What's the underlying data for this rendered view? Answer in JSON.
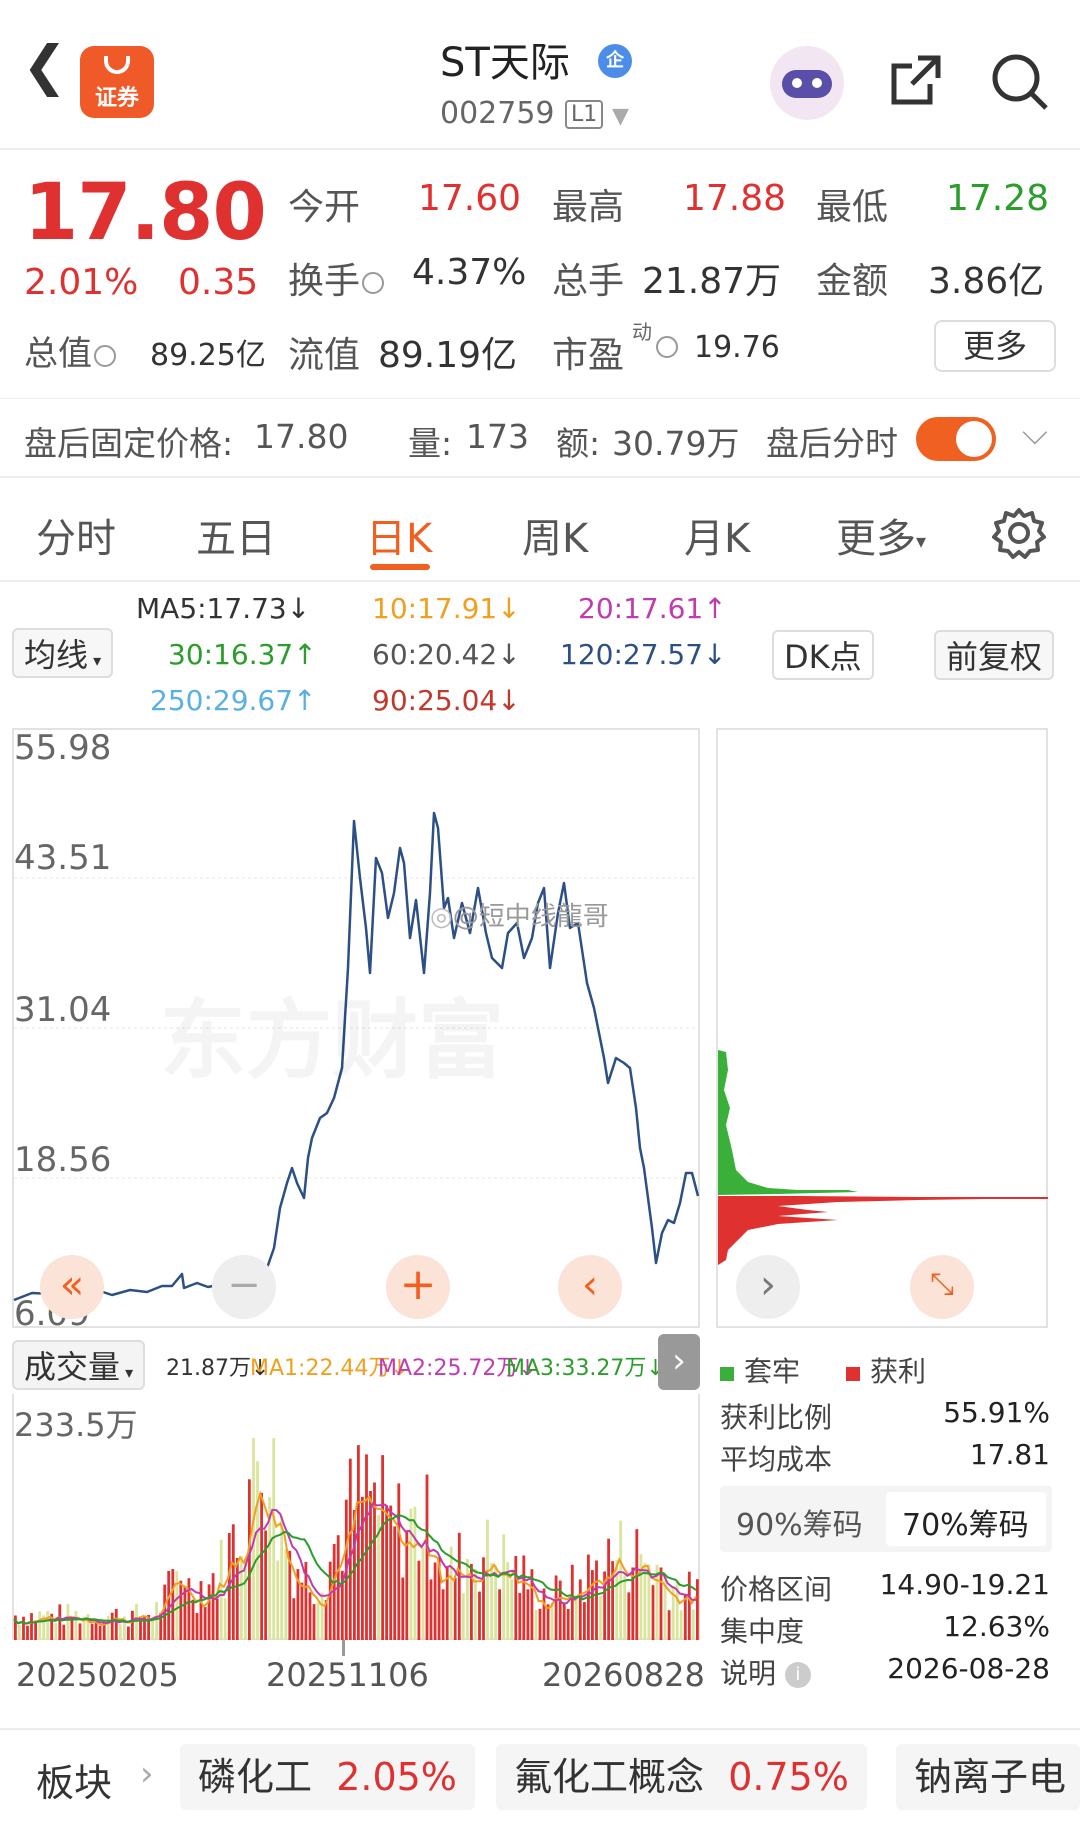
{
  "header": {
    "app_logo_text": "证券",
    "title": "ST天际",
    "title_badge": "企",
    "stock_code": "002759",
    "level_badge": "L1"
  },
  "quote": {
    "price": "17.80",
    "change_pct": "2.01%",
    "change_amt": "0.35",
    "labels": {
      "open": "今开",
      "high": "最高",
      "low": "最低",
      "turnover": "换手",
      "volume": "总手",
      "amount": "金额",
      "total_cap": "总值",
      "float_cap": "流值",
      "pe": "市盈"
    },
    "open": "17.60",
    "high": "17.88",
    "low": "17.28",
    "turnover": "4.37%",
    "volume": "21.87万",
    "amount": "3.86亿",
    "total_cap": "89.25亿",
    "float_cap": "89.19亿",
    "pe_sup": "动",
    "pe": "19.76",
    "more": "更多"
  },
  "after_hours": {
    "label": "盘后固定价格:",
    "price": "17.80",
    "vol_label": "量:",
    "vol": "173",
    "amt_label": "额:",
    "amt": "30.79万",
    "timeshare_label": "盘后分时"
  },
  "tabs": [
    "分时",
    "五日",
    "日K",
    "周K",
    "月K",
    "更多"
  ],
  "active_tab": "日K",
  "ma_legend": {
    "ma_button": "均线",
    "ma5": "MA5:17.73↓",
    "ma10": "10:17.91↓",
    "ma20": "20:17.61↑",
    "ma30": "30:16.37↑",
    "ma60": "60:20.42↓",
    "ma120": "120:27.57↓",
    "ma250": "250:29.67↑",
    "ma90": "90:25.04↓",
    "dk_button": "DK点",
    "adjust_button": "前复权"
  },
  "colors": {
    "up": "#e03131",
    "down": "#2a9d2a",
    "accent": "#f06020",
    "line": "#2c4f86",
    "ma10": "#f0a020",
    "ma20": "#c03ab0",
    "ma30": "#2a9d2a",
    "ma120": "#2c4f86",
    "ma250": "#5ab0e0",
    "ma90": "#c0392b"
  },
  "price_chart": {
    "y_ticks": [
      "55.98",
      "43.51",
      "31.04",
      "18.56",
      "6.09"
    ],
    "watermark_handle": "@短中线龍哥",
    "watermark_brand": "东方财富"
  },
  "volume_chart": {
    "selector": "成交量",
    "vol": "21.87万↓",
    "ma1": "MA1:22.44万↓",
    "ma2": "MA2:25.72万↓",
    "ma3": "MA3:33.27万↓",
    "y_max": "233.5万",
    "x_labels": [
      "20250205",
      "20251106",
      "20260828"
    ]
  },
  "chip_panel": {
    "legend_trapped": "套牢",
    "legend_profit": "获利",
    "profit_ratio_label": "获利比例",
    "profit_ratio": "55.91%",
    "avg_cost_label": "平均成本",
    "avg_cost": "17.81",
    "seg_90": "90%筹码",
    "seg_70": "70%筹码",
    "range_label": "价格区间",
    "range": "14.90-19.21",
    "concentration_label": "集中度",
    "concentration": "12.63%",
    "note_label": "说明",
    "date": "2026-08-28"
  },
  "sectors": {
    "label": "板块",
    "items": [
      {
        "name": "磷化工",
        "pct": "2.05%"
      },
      {
        "name": "氟化工概念",
        "pct": "0.75%"
      },
      {
        "name": "钠离子电",
        "pct": ""
      }
    ]
  }
}
